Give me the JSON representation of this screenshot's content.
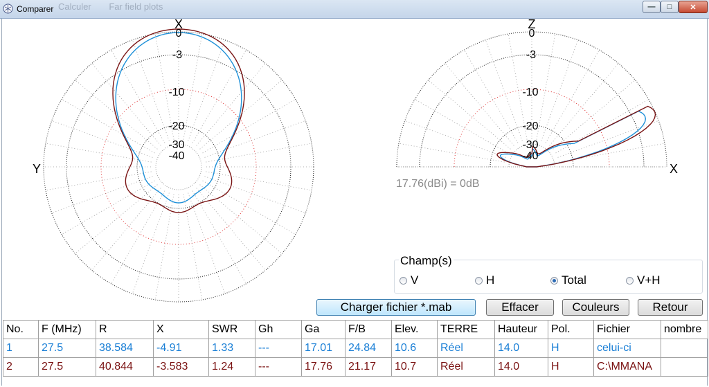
{
  "window": {
    "title": "Comparer",
    "background_tabs": [
      "Calculer",
      "Far field plots"
    ]
  },
  "plots": {
    "azimuth": {
      "top_axis": "X",
      "left_axis": "Y",
      "ring_labels": [
        "0",
        "-3",
        "-10",
        "-20",
        "-30",
        "-40"
      ]
    },
    "elevation": {
      "top_axis": "Z",
      "right_axis": "X",
      "ring_labels": [
        "0",
        "-3",
        "-10",
        "-20",
        "-30",
        "-40"
      ],
      "reference": "17.76(dBi) = 0dB"
    },
    "series_colors": {
      "file1": "#1e90d8",
      "file2": "#7a1515"
    },
    "grid_colors": {
      "major": "#222222",
      "minor": "#999999",
      "accent": "#e03030"
    }
  },
  "champs": {
    "title": "Champ(s)",
    "options": [
      {
        "label": "V",
        "selected": false
      },
      {
        "label": "H",
        "selected": false
      },
      {
        "label": "Total",
        "selected": true
      },
      {
        "label": "V+H",
        "selected": false
      }
    ]
  },
  "buttons": {
    "load": "Charger fichier *.mab",
    "clear": "Effacer",
    "colors": "Couleurs",
    "back": "Retour"
  },
  "table": {
    "headers": [
      "No.",
      "F (MHz)",
      "R",
      "X",
      "SWR",
      "Gh",
      "Ga",
      "F/B",
      "Elev.",
      "TERRE",
      "Hauteur",
      "Pol.",
      "Fichier",
      "nombre"
    ],
    "rows": [
      [
        "1",
        "27.5",
        "38.584",
        "-4.91",
        "1.33",
        "---",
        "17.01",
        "24.84",
        "10.6",
        "Réel",
        "14.0",
        "H",
        "celui-ci",
        ""
      ],
      [
        "2",
        "27.5",
        "40.844",
        "-3.583",
        "1.24",
        "---",
        "17.76",
        "21.17",
        "10.7",
        "Réel",
        "14.0",
        "H",
        "C:\\MMANA",
        ""
      ]
    ]
  }
}
